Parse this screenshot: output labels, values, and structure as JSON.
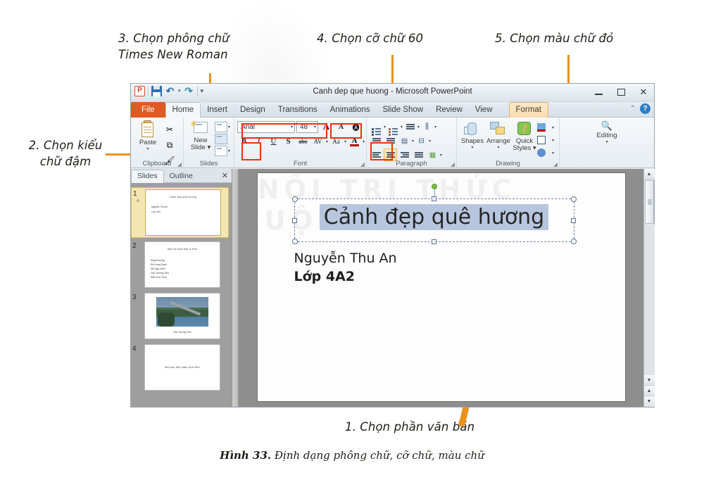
{
  "figure": {
    "caption_label": "Hình 33.",
    "caption_text": " Định dạng phông chữ, cỡ chữ, màu chữ"
  },
  "callouts": {
    "one": "1. Chọn phần văn bản",
    "two": "2. Chọn kiểu\nchữ đậm",
    "three": "3. Chọn phông chữ\nTimes New Roman",
    "four": "4. Chọn cỡ chữ 60",
    "five": "5. Chọn màu chữ đỏ"
  },
  "window": {
    "title": "Canh dep que huong  -  Microsoft PowerPoint",
    "logo_text": "P",
    "quick_access": {
      "save_icon": "save-icon",
      "undo_icon": "undo-icon",
      "redo_icon": "redo-icon",
      "more_icon": "chevron-down-icon"
    },
    "controls": {
      "minimize": "minimize-icon",
      "maximize": "maximize-icon",
      "close": "✕"
    }
  },
  "tabs": [
    {
      "label": "File",
      "state": "file"
    },
    {
      "label": "Home",
      "state": "active"
    },
    {
      "label": "Insert",
      "state": "normal"
    },
    {
      "label": "Design",
      "state": "normal"
    },
    {
      "label": "Transitions",
      "state": "normal"
    },
    {
      "label": "Animations",
      "state": "normal"
    },
    {
      "label": "Slide Show",
      "state": "normal"
    },
    {
      "label": "Review",
      "state": "normal"
    },
    {
      "label": "View",
      "state": "normal"
    },
    {
      "label": "Format",
      "state": "contextual"
    }
  ],
  "tab_right": {
    "collapse_icon": "collapse-ribbon-icon",
    "help_icon": "?"
  },
  "ribbon": {
    "groups": [
      {
        "label": "Clipboard"
      },
      {
        "label": "Slides"
      },
      {
        "label": "Font"
      },
      {
        "label": "Paragraph"
      },
      {
        "label": "Drawing"
      },
      {
        "label": ""
      }
    ],
    "clipboard": {
      "paste_label": "Paste",
      "paste_caret": "▾",
      "cut_icon": "scissors-icon",
      "copy_icon": "copy-icon",
      "format_painter_icon": "format-painter-icon"
    },
    "slides": {
      "new_slide_label": "New\nSlide ▾",
      "layout_icon": "layout-icon",
      "reset_icon": "reset-icon",
      "section_icon": "section-icon"
    },
    "font": {
      "font_name": "Arial",
      "font_size": "48",
      "grow_label": "A",
      "shrink_label": "A",
      "clear_formatting_icon": "clear-formatting-icon",
      "bold_label": "B",
      "italic_label": "I",
      "underline_label": "U",
      "shadow_label": "S",
      "strikethrough_label": "abc",
      "spacing_label": "AV",
      "change_case_label": "Aa",
      "font_color_label": "A",
      "font_color_hex": "#c00000"
    },
    "paragraph": {
      "bullets_icon": "bullets-icon",
      "numbering_icon": "numbering-icon",
      "line_spacing_icon": "line-spacing-icon",
      "text_direction_icon": "text-direction-icon",
      "decrease_indent_icon": "decrease-indent-icon",
      "increase_indent_icon": "increase-indent-icon",
      "columns_icon": "columns-icon",
      "align_text_icon": "align-text-icon",
      "align_left_icon": "align-left-icon",
      "align_center_icon": "align-center-icon",
      "align_right_icon": "align-right-icon",
      "justify_icon": "justify-icon",
      "smartart_icon": "smartart-icon"
    },
    "drawing": {
      "shapes_label": "Shapes",
      "arrange_label": "Arrange",
      "quick_styles_label": "Quick\nStyles ▾",
      "shape_fill_icon": "shape-fill-icon",
      "shape_outline_icon": "shape-outline-icon",
      "shape_effects_icon": "shape-effects-icon"
    },
    "editing": {
      "label": "Editing",
      "icon": "find-binoculars-icon"
    }
  },
  "slides_pane": {
    "tab_slides": "Slides",
    "tab_outline": "Outline",
    "close_icon": "✕",
    "thumbnails": [
      {
        "number": "1",
        "title": "Cảnh đẹp quê hương",
        "lines": [
          "Nguyễn Thu An",
          "Lớp 4A2"
        ],
        "selected": true
      },
      {
        "number": "2",
        "title": "Một số cảnh đẹp ở Huế",
        "lines": [
          "Sông Hương",
          "Đồi Vọng Cảnh",
          "Núi Ngự Bình",
          "Cầu Trường Tiền",
          "Điện Hòn Chén"
        ],
        "selected": false
      },
      {
        "number": "3",
        "title": "",
        "picture_caption": "Cầu Trường Tiền",
        "lines": [],
        "selected": false
      },
      {
        "number": "4",
        "title": "Mời bạn đến thăm Huế nhé!",
        "lines": [],
        "selected": false
      }
    ]
  },
  "slide": {
    "watermark_line1": "NỐI TRI THỨC",
    "watermark_line2": "CUỘC SỐNG",
    "title_text": "Cảnh đẹp quê hương",
    "body_line1": "Nguyễn Thu An",
    "body_line2": "Lớp 4A2",
    "selection_highlight_hex": "#b7c6de",
    "rotate_handle_hex": "#7ac143"
  },
  "scrollbar": {
    "up_arrow": "▲",
    "down_arrow": "▼",
    "prev_slide": "▲",
    "next_slide": "▼"
  },
  "annotation_color": "#E8921F",
  "highlight_color": "#E8330F"
}
